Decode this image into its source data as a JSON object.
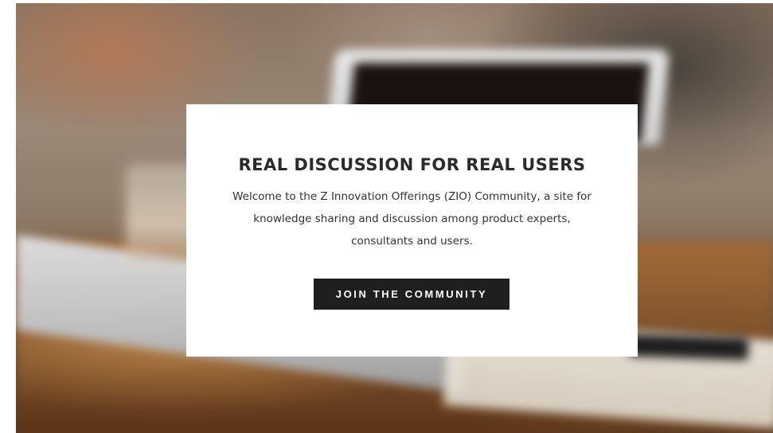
{
  "hero": {
    "title": "REAL DISCUSSION FOR REAL USERS",
    "description": "Welcome to the Z Innovation Offerings (ZIO) Community, a site for knowledge sharing and discussion among product experts, consultants and users.",
    "cta_label": "JOIN THE COMMUNITY"
  },
  "colors": {
    "card_background": "#ffffff",
    "button_background": "#1f1f1f",
    "button_text": "#ffffff",
    "title_text": "#2b2b2b"
  }
}
